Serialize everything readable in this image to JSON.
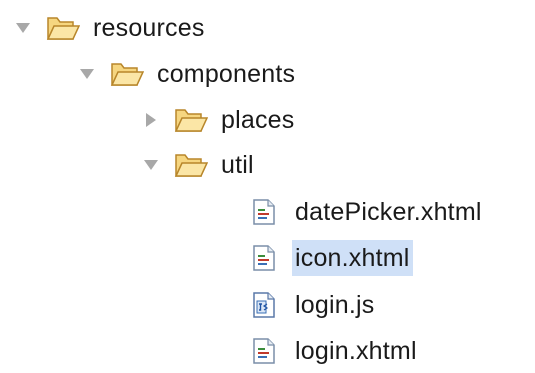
{
  "tree": {
    "resources": {
      "label": "resources",
      "state": "expanded",
      "icon": "folder-open-icon"
    },
    "components": {
      "label": "components",
      "state": "expanded",
      "icon": "folder-open-icon"
    },
    "places": {
      "label": "places",
      "state": "collapsed",
      "icon": "folder-open-icon"
    },
    "util": {
      "label": "util",
      "state": "expanded",
      "icon": "folder-open-icon"
    },
    "files": [
      {
        "label": "datePicker.xhtml",
        "icon": "xhtml-file-icon",
        "selected": false
      },
      {
        "label": "icon.xhtml",
        "icon": "xhtml-file-icon",
        "selected": true
      },
      {
        "label": "login.js",
        "icon": "javascript-file-icon",
        "selected": false
      },
      {
        "label": "login.xhtml",
        "icon": "xhtml-file-icon",
        "selected": false
      }
    ]
  },
  "colors": {
    "selection": "#cfe0f7",
    "folder": "#f2cc6a",
    "folder_outline": "#b8862a",
    "twisty": "#9a9a9a"
  }
}
